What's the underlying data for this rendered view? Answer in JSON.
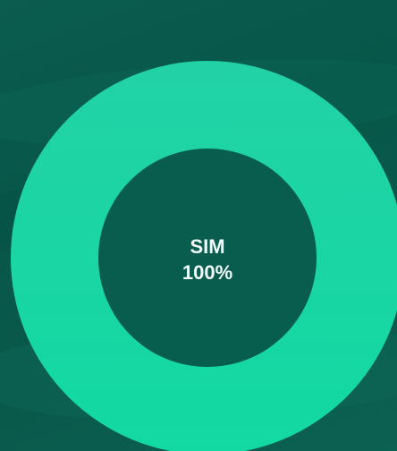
{
  "chart_data": {
    "type": "pie",
    "style": "donut",
    "categories": [
      "SIM"
    ],
    "values": [
      100
    ],
    "colors": {
      "ring_start": "#1fd6a8",
      "ring_end": "#10c99b",
      "background": "#07574a",
      "text": "#f2fbf8"
    }
  },
  "center": {
    "label": "SIM",
    "value": "100%"
  }
}
